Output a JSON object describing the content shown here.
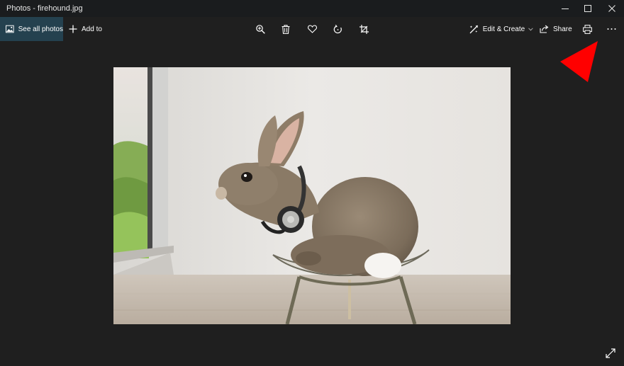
{
  "window": {
    "title": "Photos - firehound.jpg",
    "controls": [
      "minimize",
      "maximize",
      "close"
    ]
  },
  "toolbar": {
    "see_all_label": "See all photos",
    "add_to_label": "Add to",
    "edit_label": "Edit & Create",
    "share_label": "Share",
    "icons": [
      "zoom-in-icon",
      "delete-icon",
      "favorite-icon",
      "rotate-icon",
      "crop-icon",
      "print-icon",
      "more-icon"
    ]
  },
  "colors": {
    "background": "#1f1f1f",
    "titlebar": "#1a1c1e",
    "accent_selected": "#24414f",
    "annotation": "#ff0000"
  }
}
